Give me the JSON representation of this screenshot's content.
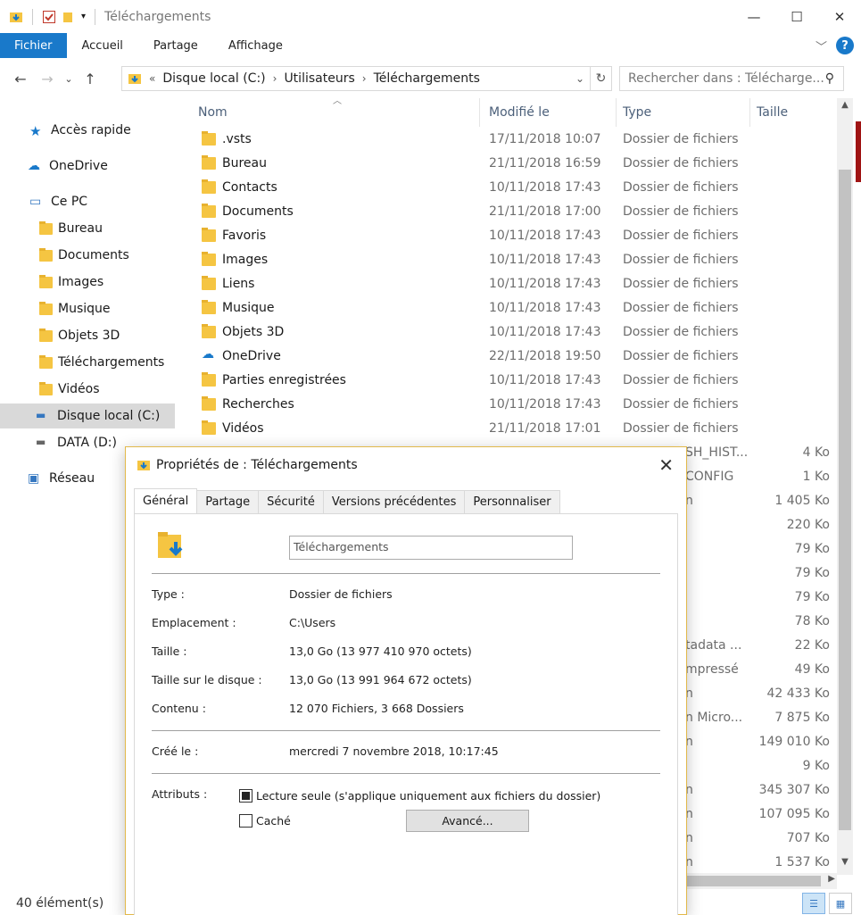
{
  "window": {
    "title": "Téléchargements",
    "controls": [
      "minimize-icon",
      "maximize-icon",
      "close-icon"
    ]
  },
  "ribbon": {
    "tabs": [
      "Fichier",
      "Accueil",
      "Partage",
      "Affichage"
    ]
  },
  "address": {
    "breadcrumbs": [
      "Disque local (C:)",
      "Utilisateurs",
      "Téléchargements"
    ],
    "search_placeholder": "Rechercher dans : Télécharge..."
  },
  "sidebar": {
    "items": [
      {
        "label": "Accès rapide",
        "icon": "star-icon"
      },
      {
        "label": "OneDrive",
        "icon": "cloud-icon"
      },
      {
        "label": "Ce PC",
        "icon": "computer-icon"
      },
      {
        "label": "Bureau",
        "icon": "desktop-folder-icon"
      },
      {
        "label": "Documents",
        "icon": "documents-folder-icon"
      },
      {
        "label": "Images",
        "icon": "images-folder-icon"
      },
      {
        "label": "Musique",
        "icon": "music-folder-icon"
      },
      {
        "label": "Objets 3D",
        "icon": "3d-folder-icon"
      },
      {
        "label": "Téléchargements",
        "icon": "downloads-folder-icon"
      },
      {
        "label": "Vidéos",
        "icon": "videos-folder-icon"
      },
      {
        "label": "Disque local (C:)",
        "icon": "drive-icon"
      },
      {
        "label": "DATA (D:)",
        "icon": "drive-icon"
      },
      {
        "label": "Réseau",
        "icon": "network-icon"
      }
    ],
    "selected": "Disque local (C:)"
  },
  "filelist": {
    "columns": [
      "Nom",
      "Modifié le",
      "Type",
      "Taille"
    ],
    "rows": [
      {
        "name": ".vsts",
        "date": "17/11/2018 10:07",
        "type": "Dossier de fichiers",
        "size": ""
      },
      {
        "name": "Bureau",
        "date": "21/11/2018 16:59",
        "type": "Dossier de fichiers",
        "size": ""
      },
      {
        "name": "Contacts",
        "date": "10/11/2018 17:43",
        "type": "Dossier de fichiers",
        "size": ""
      },
      {
        "name": "Documents",
        "date": "21/11/2018 17:00",
        "type": "Dossier de fichiers",
        "size": ""
      },
      {
        "name": "Favoris",
        "date": "10/11/2018 17:43",
        "type": "Dossier de fichiers",
        "size": ""
      },
      {
        "name": "Images",
        "date": "10/11/2018 17:43",
        "type": "Dossier de fichiers",
        "size": ""
      },
      {
        "name": "Liens",
        "date": "10/11/2018 17:43",
        "type": "Dossier de fichiers",
        "size": ""
      },
      {
        "name": "Musique",
        "date": "10/11/2018 17:43",
        "type": "Dossier de fichiers",
        "size": ""
      },
      {
        "name": "Objets 3D",
        "date": "10/11/2018 17:43",
        "type": "Dossier de fichiers",
        "size": ""
      },
      {
        "name": "OneDrive",
        "date": "22/11/2018 19:50",
        "type": "Dossier de fichiers",
        "size": ""
      },
      {
        "name": "Parties enregistrées",
        "date": "10/11/2018 17:43",
        "type": "Dossier de fichiers",
        "size": ""
      },
      {
        "name": "Recherches",
        "date": "10/11/2018 17:43",
        "type": "Dossier de fichiers",
        "size": ""
      },
      {
        "name": "Vidéos",
        "date": "21/11/2018 17:01",
        "type": "Dossier de fichiers",
        "size": ""
      }
    ],
    "partial_rows": [
      {
        "type_tail": "SH_HIST...",
        "size": "4 Ko"
      },
      {
        "type_tail": "CONFIG",
        "size": "1 Ko"
      },
      {
        "type_tail": "n",
        "size": "1 405 Ko"
      },
      {
        "type_tail": "",
        "size": "220 Ko"
      },
      {
        "type_tail": "",
        "size": "79 Ko"
      },
      {
        "type_tail": "",
        "size": "79 Ko"
      },
      {
        "type_tail": "",
        "size": "79 Ko"
      },
      {
        "type_tail": "",
        "size": "78 Ko"
      },
      {
        "type_tail": "tadata ...",
        "size": "22 Ko"
      },
      {
        "type_tail": "mpressé",
        "size": "49 Ko"
      },
      {
        "type_tail": "n",
        "size": "42 433 Ko"
      },
      {
        "type_tail": "n Micro...",
        "size": "7 875 Ko"
      },
      {
        "type_tail": "n",
        "size": "149 010 Ko"
      },
      {
        "type_tail": "",
        "size": "9 Ko"
      },
      {
        "type_tail": "n",
        "size": "345 307 Ko"
      },
      {
        "type_tail": "n",
        "size": "107 095 Ko"
      },
      {
        "type_tail": "n",
        "size": "707 Ko"
      },
      {
        "type_tail": "n",
        "size": "1 537 Ko"
      }
    ]
  },
  "status": {
    "count": "40 élément(s)"
  },
  "dialog": {
    "title": "Propriétés de : Téléchargements",
    "tabs": [
      "Général",
      "Partage",
      "Sécurité",
      "Versions précédentes",
      "Personnaliser"
    ],
    "active_tab": "Général",
    "folder_name": "Téléchargements",
    "fields": {
      "type_label": "Type :",
      "type_value": "Dossier de fichiers",
      "location_label": "Emplacement :",
      "location_value": "C:\\Users",
      "size_label": "Taille :",
      "size_value": "13,0 Go (13 977 410 970 octets)",
      "disk_label": "Taille sur le disque :",
      "disk_value": "13,0 Go (13 991 964 672 octets)",
      "content_label": "Contenu :",
      "content_value": "12 070 Fichiers, 3 668 Dossiers",
      "created_label": "Créé le :",
      "created_value": "mercredi 7 novembre 2018, 10:17:45",
      "attributes_label": "Attributs :"
    },
    "readonly_label": "Lecture seule (s'applique uniquement aux fichiers du dossier)",
    "hidden_label": "Caché",
    "advanced_button": "Avancé..."
  }
}
